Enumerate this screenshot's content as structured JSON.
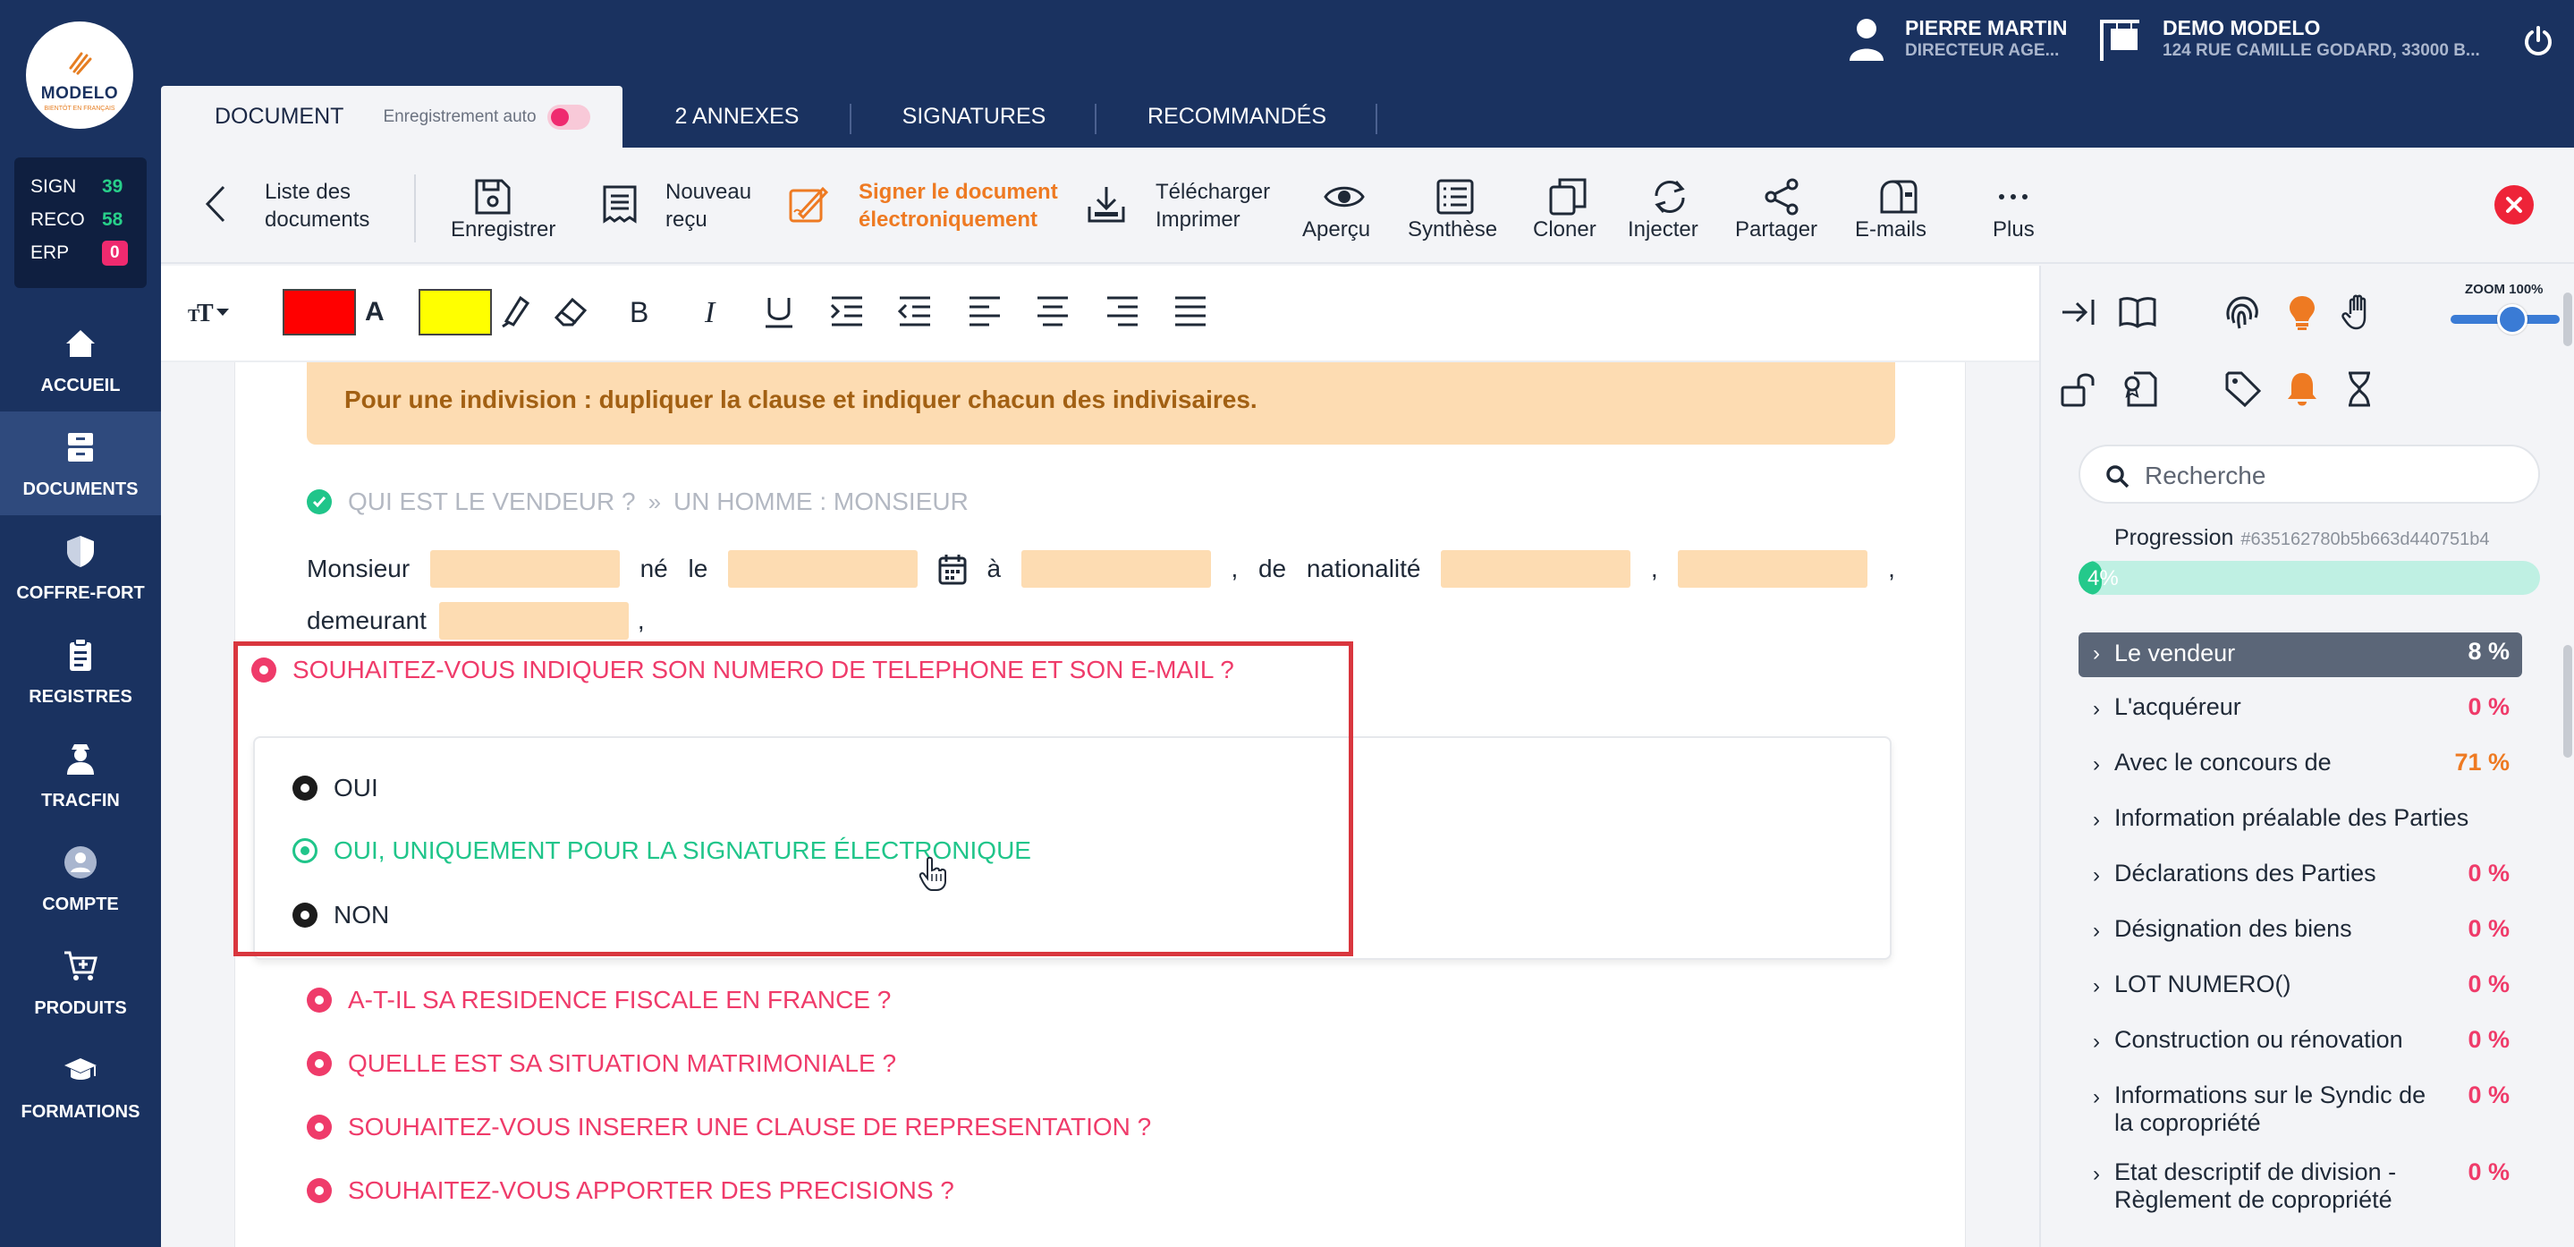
{
  "brand": {
    "name": "MODELO",
    "tagline": "BIENTÔT EN FRANÇAIS"
  },
  "counters": [
    {
      "label": "SIGN",
      "value": "39"
    },
    {
      "label": "RECO",
      "value": "58"
    },
    {
      "label": "ERP",
      "value": "0"
    }
  ],
  "nav": [
    {
      "label": "ACCUEIL",
      "icon": "home-icon"
    },
    {
      "label": "DOCUMENTS",
      "icon": "documents-icon",
      "active": true
    },
    {
      "label": "COFFRE-FORT",
      "icon": "shield-icon"
    },
    {
      "label": "REGISTRES",
      "icon": "clipboard-icon"
    },
    {
      "label": "TRACFIN",
      "icon": "agent-icon"
    },
    {
      "label": "COMPTE",
      "icon": "user-icon"
    },
    {
      "label": "PRODUITS",
      "icon": "cart-icon"
    },
    {
      "label": "FORMATIONS",
      "icon": "graduation-icon"
    }
  ],
  "user": {
    "name": "PIERRE MARTIN",
    "role": "DIRECTEUR AGE..."
  },
  "agency": {
    "name": "DEMO MODELO",
    "address": "124 RUE CAMILLE GODARD, 33000 B..."
  },
  "tabs": {
    "document": "DOCUMENT",
    "autosave": "Enregistrement auto",
    "annexes": "2 ANNEXES",
    "signatures": "SIGNATURES",
    "recommandes": "RECOMMANDÉS"
  },
  "toolbar": {
    "back": [
      "Liste des",
      "documents"
    ],
    "save": "Enregistrer",
    "receipt": [
      "Nouveau",
      "reçu"
    ],
    "sign": [
      "Signer le document",
      "électroniquement"
    ],
    "download": [
      "Télécharger",
      "Imprimer"
    ],
    "preview": "Aperçu",
    "synthesis": "Synthèse",
    "clone": "Cloner",
    "inject": "Injecter",
    "share": "Partager",
    "emails": "E-mails",
    "more": "Plus"
  },
  "colors": {
    "text_color": "#ff0000",
    "highlight_color": "#ffff00",
    "brand": "#1a3260",
    "accent": "#ee7a22",
    "alert": "#ef3b6a",
    "success": "#20c58a"
  },
  "document": {
    "banner": "Pour une indivision : dupliquer la clause et indiquer chacun des indivisaires.",
    "answered_question": "QUI EST LE VENDEUR ?",
    "answered_value": "UN HOMME : MONSIEUR",
    "sentence": {
      "w1": "Monsieur",
      "w2": "né",
      "w3": "le",
      "w4": "à",
      "w5": ",",
      "w6": "de",
      "w7": "nationalité",
      "w8": ",",
      "w9": ",",
      "w10": "demeurant",
      "w11": ","
    },
    "active_question": "SOUHAITEZ-VOUS INDIQUER SON NUMERO DE TELEPHONE ET SON E-MAIL ?",
    "options": [
      "OUI",
      "OUI, UNIQUEMENT POUR LA SIGNATURE ÉLECTRONIQUE",
      "NON"
    ],
    "pending_questions": [
      "A-T-IL SA RESIDENCE FISCALE EN FRANCE ?",
      "QUELLE EST SA SITUATION MATRIMONIALE ?",
      "SOUHAITEZ-VOUS INSERER UNE CLAUSE DE REPRESENTATION ?",
      "SOUHAITEZ-VOUS APPORTER DES PRECISIONS ?"
    ]
  },
  "panel": {
    "zoom": "ZOOM 100%",
    "zoom_level": 1.0,
    "search_placeholder": "Recherche",
    "progress_label": "Progression",
    "progress_hash": "#635162780b5b663d440751b4",
    "progress_text": "4%",
    "progress_value": 0.04,
    "sections": [
      {
        "label": "Le vendeur",
        "pct": "8 %",
        "color": "white",
        "active": true
      },
      {
        "label": "L'acquéreur",
        "pct": "0 %",
        "color": "red"
      },
      {
        "label": "Avec le concours de",
        "pct": "71 %",
        "color": "orange"
      },
      {
        "label": "Information préalable des Parties",
        "pct": "",
        "color": "red"
      },
      {
        "label": "Déclarations des Parties",
        "pct": "0 %",
        "color": "red"
      },
      {
        "label": "Désignation des biens",
        "pct": "0 %",
        "color": "red"
      },
      {
        "label": "LOT NUMERO()",
        "pct": "0 %",
        "color": "red"
      },
      {
        "label": "Construction ou rénovation",
        "pct": "0 %",
        "color": "red"
      },
      {
        "label": "Informations sur le Syndic de la copropriété",
        "pct": "0 %",
        "color": "red"
      },
      {
        "label": "Etat descriptif de division - Règlement de copropriété",
        "pct": "0 %",
        "color": "red"
      }
    ]
  }
}
